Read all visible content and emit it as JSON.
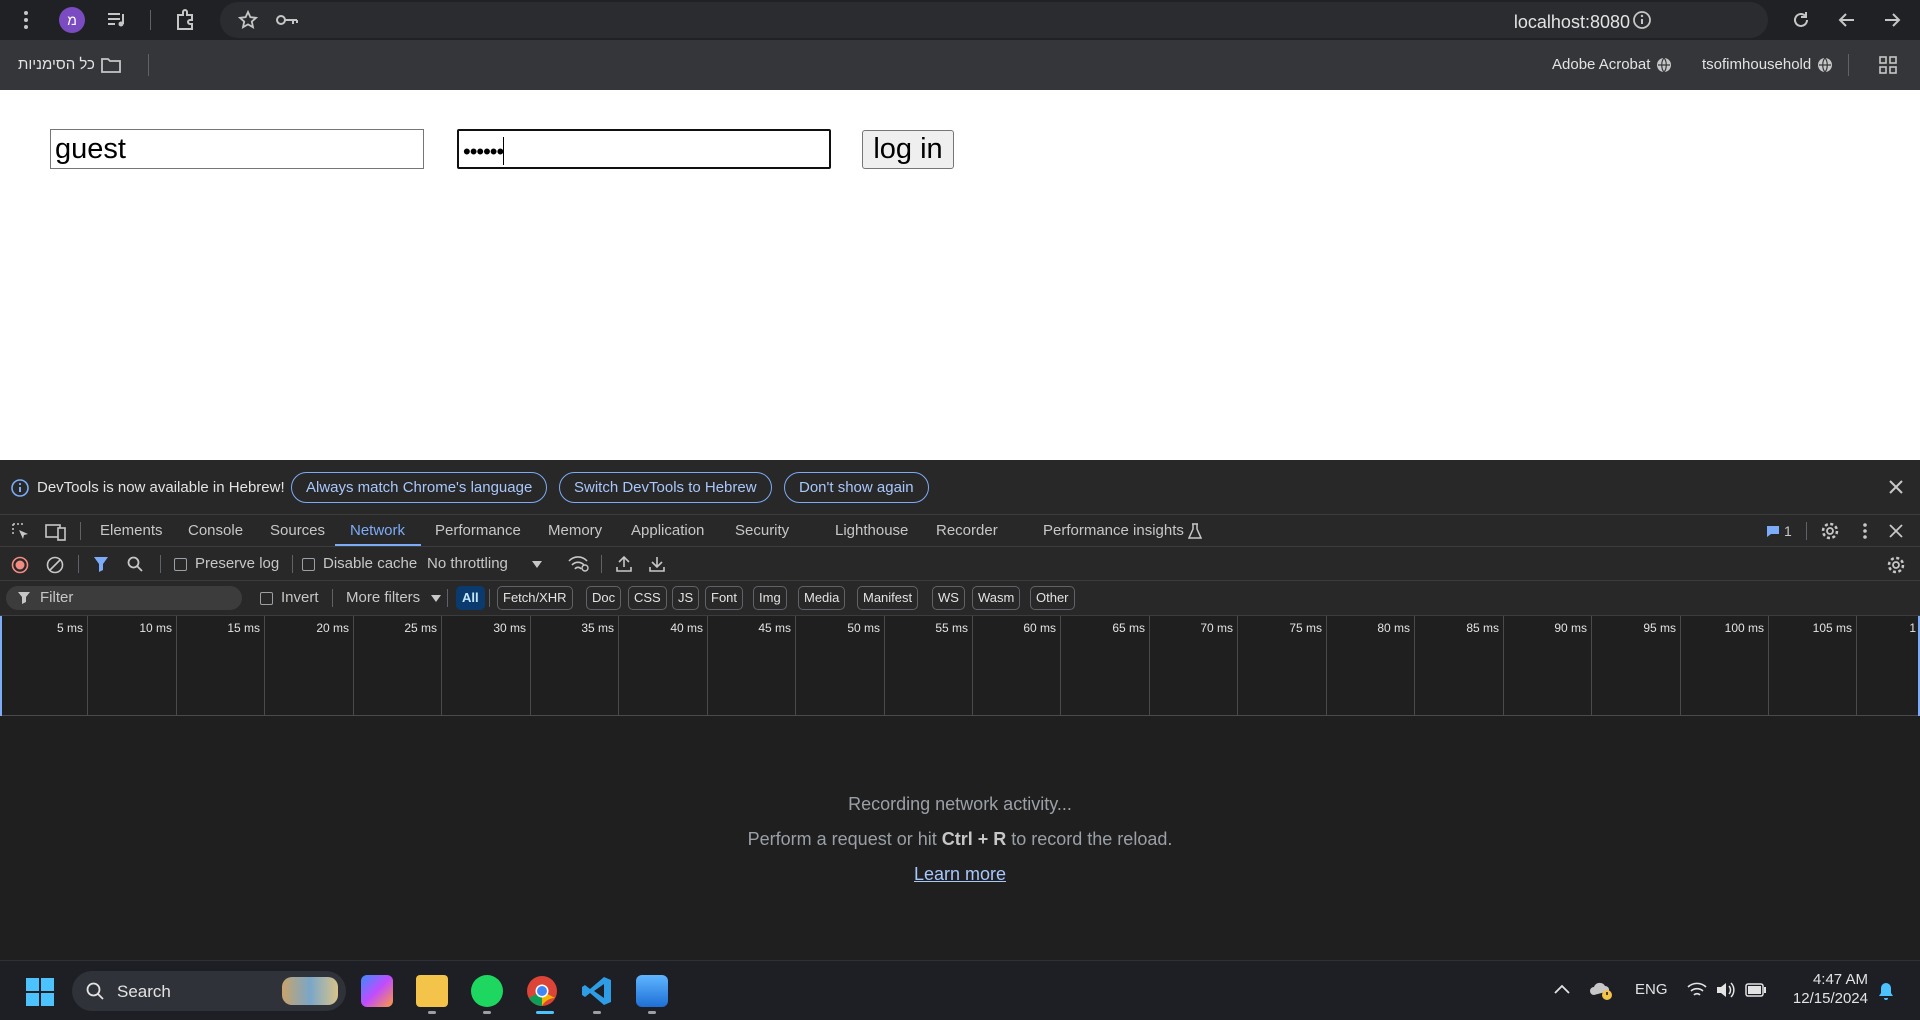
{
  "browser": {
    "url": "localhost:8080",
    "profile_initial": "מ",
    "bookmarks_all_label": "כל הסימניות",
    "bookmarks": [
      {
        "label": "Adobe Acrobat"
      },
      {
        "label": "tsofimhousehold"
      }
    ]
  },
  "page": {
    "username_value": "guest",
    "password_value": "••••••",
    "login_label": "log in"
  },
  "devtools": {
    "info_message": "DevTools is now available in Hebrew!",
    "info_buttons": [
      "Always match Chrome's language",
      "Switch DevTools to Hebrew",
      "Don't show again"
    ],
    "tabs": [
      "Elements",
      "Console",
      "Sources",
      "Network",
      "Performance",
      "Memory",
      "Application",
      "Security",
      "Lighthouse",
      "Recorder",
      "Performance insights"
    ],
    "active_tab": "Network",
    "issues_count": "1",
    "toolbar": {
      "preserve_log": "Preserve log",
      "disable_cache": "Disable cache",
      "throttling": "No throttling"
    },
    "filter": {
      "placeholder": "Filter",
      "invert": "Invert",
      "more_filters": "More filters",
      "types": [
        "All",
        "Fetch/XHR",
        "Doc",
        "CSS",
        "JS",
        "Font",
        "Img",
        "Media",
        "Manifest",
        "WS",
        "Wasm",
        "Other"
      ],
      "selected_type": "All"
    },
    "timeline_ticks": [
      "5 ms",
      "10 ms",
      "15 ms",
      "20 ms",
      "25 ms",
      "30 ms",
      "35 ms",
      "40 ms",
      "45 ms",
      "50 ms",
      "55 ms",
      "60 ms",
      "65 ms",
      "70 ms",
      "75 ms",
      "80 ms",
      "85 ms",
      "90 ms",
      "95 ms",
      "100 ms",
      "105 ms",
      "1"
    ],
    "empty_state": {
      "line1": "Recording network activity...",
      "line2_pre": "Perform a request or hit ",
      "line2_key": "Ctrl + R",
      "line2_post": " to record the reload.",
      "link": "Learn more"
    }
  },
  "taskbar": {
    "search_label": "Search",
    "language": "ENG",
    "time": "4:47 AM",
    "date": "12/15/2024"
  }
}
